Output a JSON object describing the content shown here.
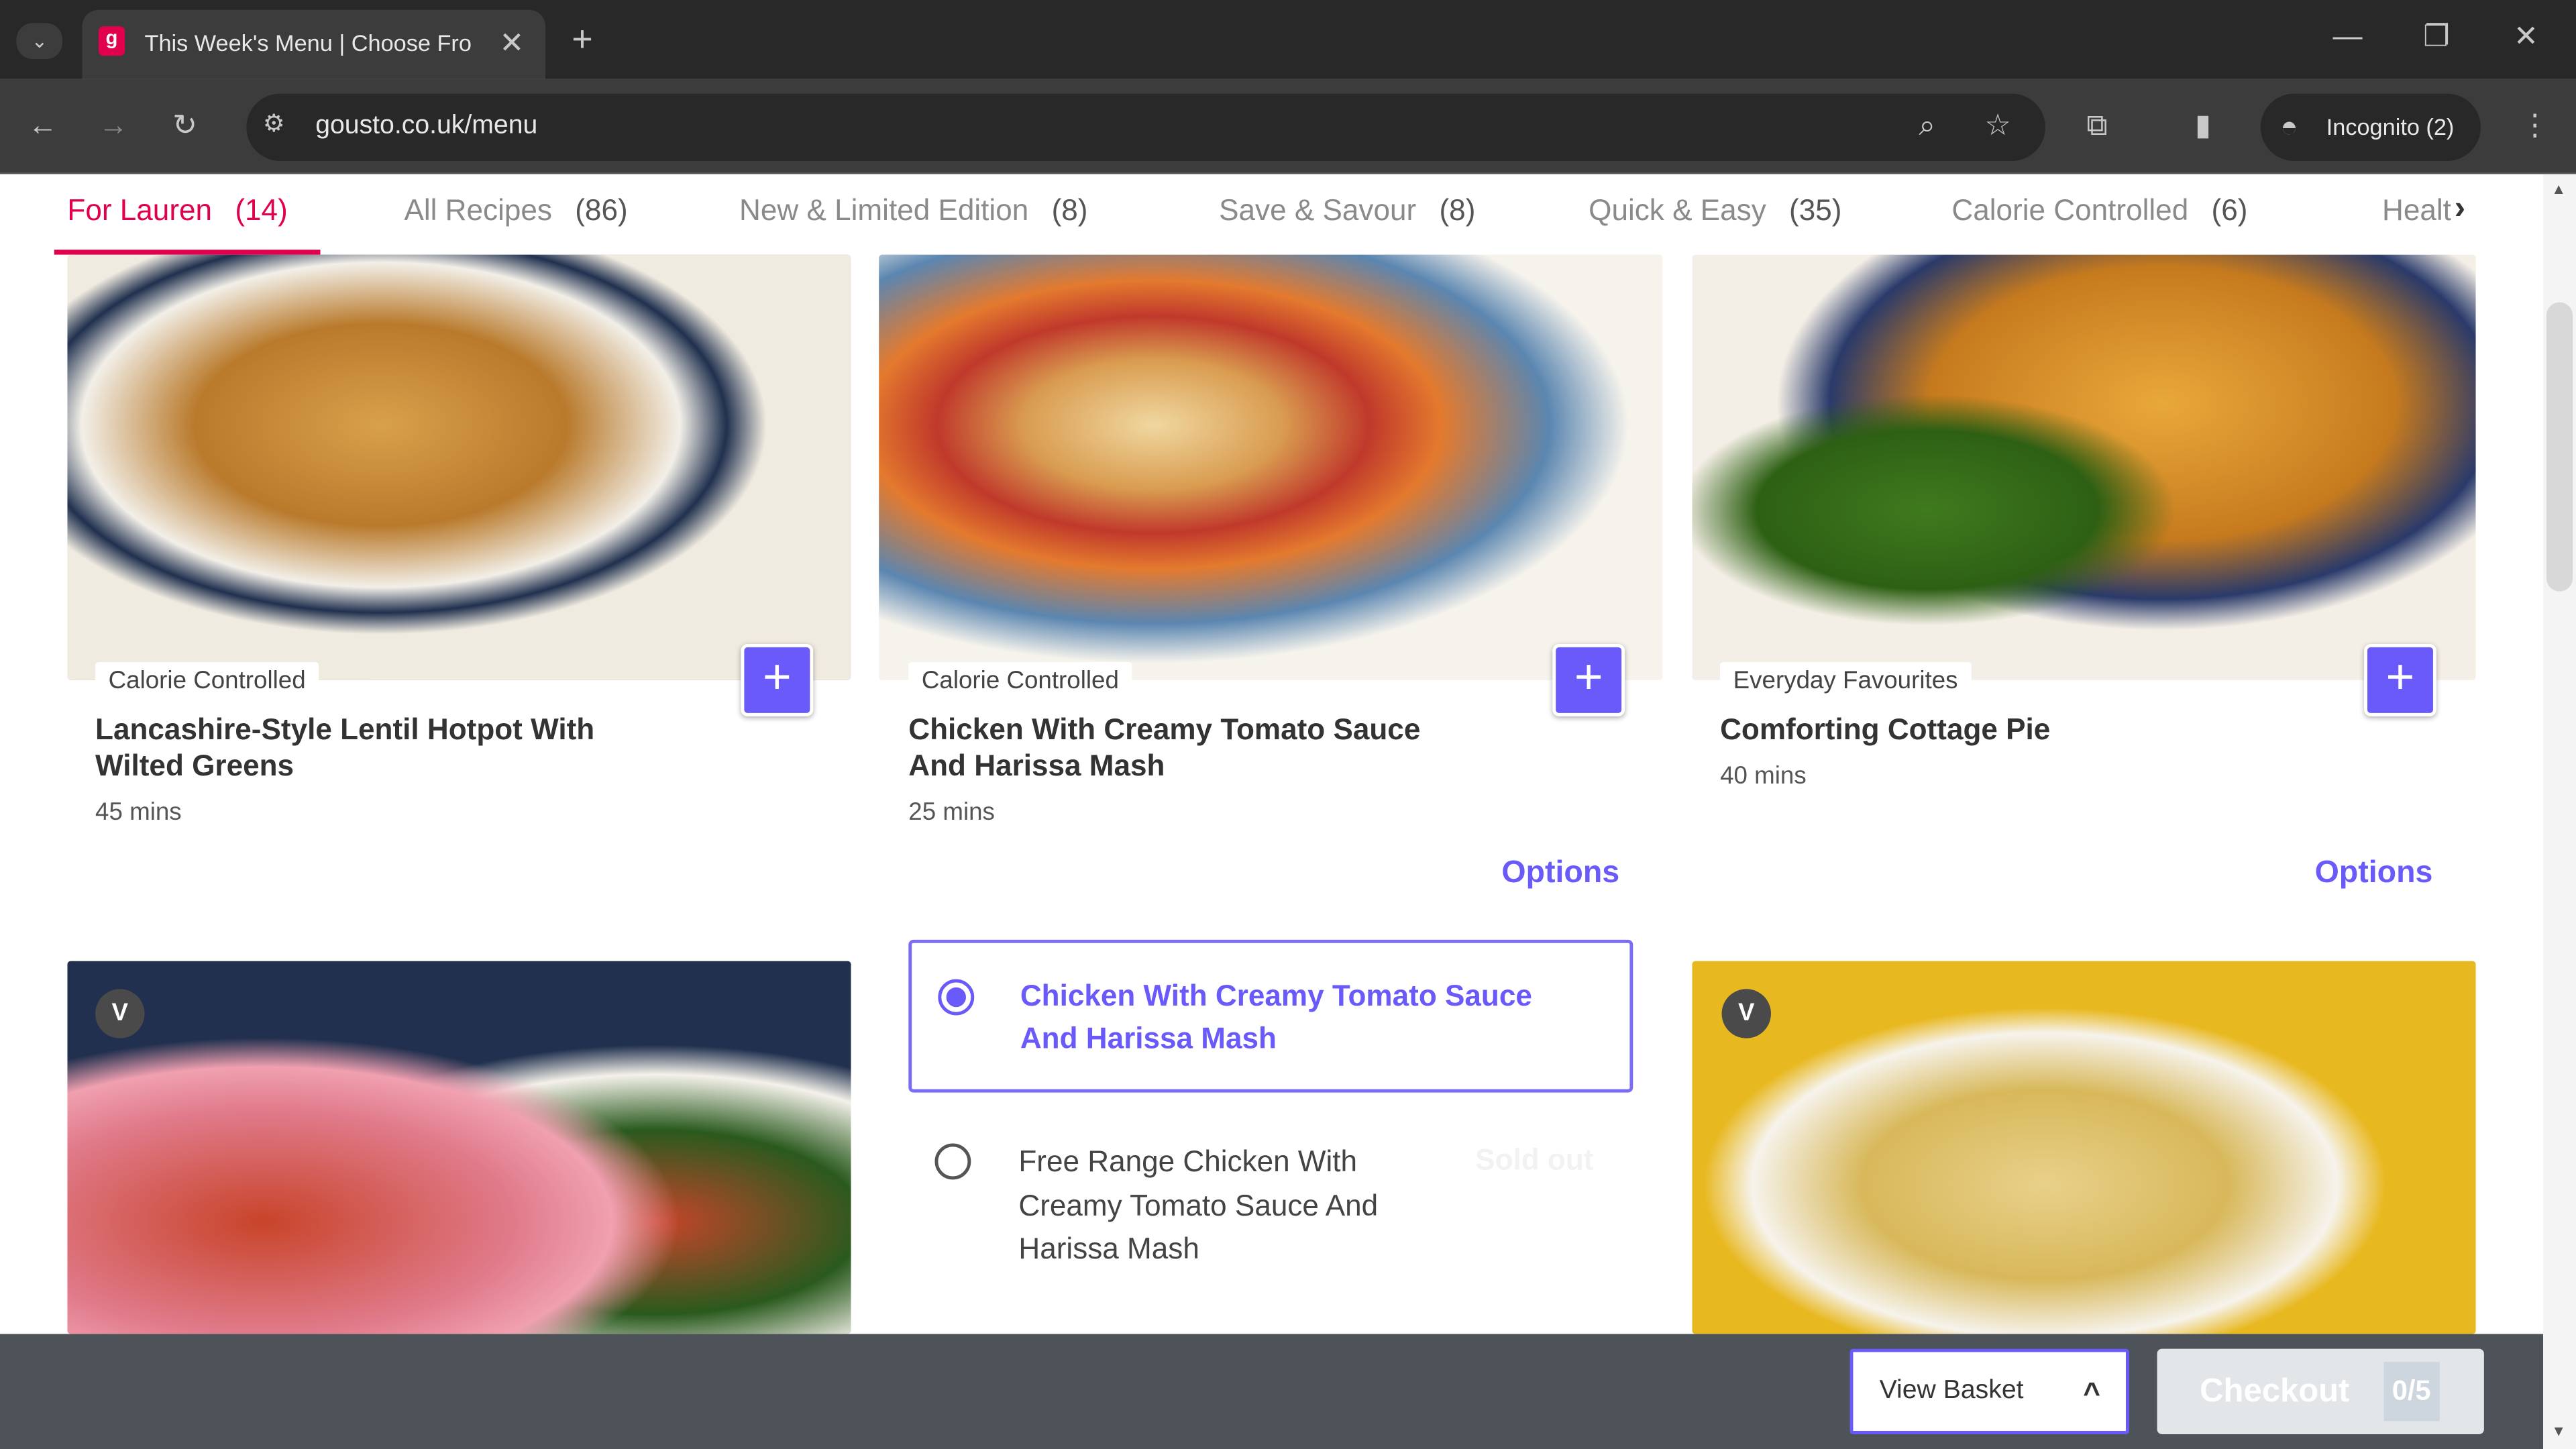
{
  "browser": {
    "tab_title": "This Week's Menu | Choose Fro",
    "url": "gousto.co.uk/menu",
    "profile": "Incognito (2)"
  },
  "nav_tabs": [
    {
      "label": "For Lauren",
      "count": "(14)",
      "active": true
    },
    {
      "label": "All Recipes",
      "count": "(86)"
    },
    {
      "label": "New & Limited Edition",
      "count": "(8)"
    },
    {
      "label": "Save & Savour",
      "count": "(8)"
    },
    {
      "label": "Quick & Easy",
      "count": "(35)"
    },
    {
      "label": "Calorie Controlled",
      "count": "(6)"
    },
    {
      "label": "Healt",
      "count": ""
    }
  ],
  "recipes": [
    {
      "tag": "Calorie Controlled",
      "title": "Lancashire-Style Lentil Hotpot With Wilted Greens",
      "time": "45 mins"
    },
    {
      "tag": "Calorie Controlled",
      "title": "Chicken With Creamy Tomato Sauce And Harissa Mash",
      "time": "25 mins",
      "options_label": "Options"
    },
    {
      "tag": "Everyday Favourites",
      "title": "Comforting Cottage Pie",
      "time": "40 mins",
      "options_label": "Options"
    }
  ],
  "options_panel": {
    "selected": "Chicken With Creamy Tomato Sauce And Harissa Mash",
    "other": "Free Range Chicken With Creamy Tomato Sauce And Harissa Mash",
    "other_status": "Sold out"
  },
  "row2": {
    "badge_left": "V",
    "badge_right": "V"
  },
  "basket": {
    "view_label": "View Basket",
    "checkout_label": "Checkout",
    "count": "0/5"
  },
  "colors": {
    "brand": "#e0004d",
    "accent": "#6a5af9"
  }
}
